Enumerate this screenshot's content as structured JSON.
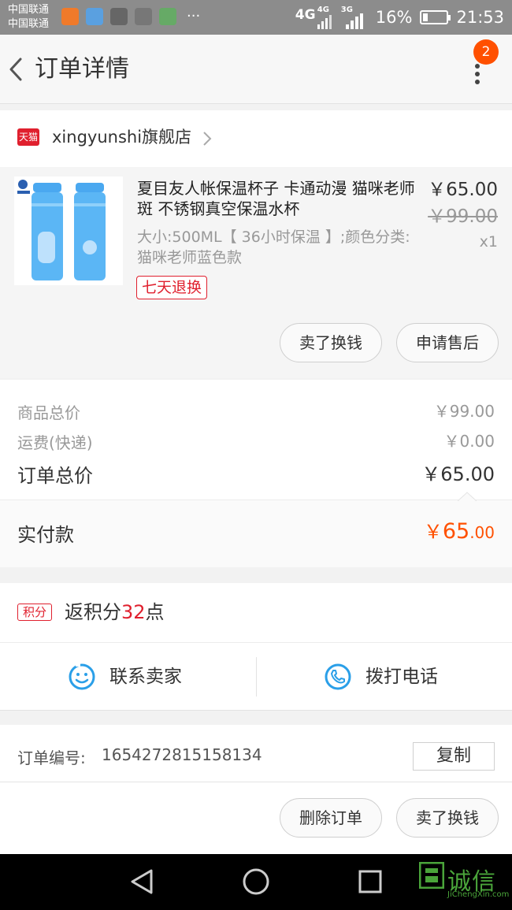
{
  "status_bar": {
    "carrier_1": "中国联通",
    "carrier_2": "中国联通",
    "more": "···",
    "net_1": "4G",
    "net_2": "4G",
    "net_3": "3G",
    "battery": "16%",
    "time": "21:53"
  },
  "header": {
    "title": "订单详情",
    "badge_count": "2"
  },
  "store": {
    "logo_text": "天猫",
    "name": "xingyunshi旗舰店"
  },
  "product": {
    "title": "夏目友人帐保温杯子 卡通动漫 猫咪老师斑 不锈钢真空保温水杯",
    "spec": "大小:500ML【 36小时保温 】;颜色分类:猫咪老师蓝色款",
    "tag": "七天退换",
    "price": "￥65.00",
    "original_price": "￥99.00",
    "quantity": "x1",
    "btn_sell": "卖了换钱",
    "btn_aftersale": "申请售后"
  },
  "summary": {
    "goods_label": "商品总价",
    "goods_value": "￥99.00",
    "shipping_label": "运费(快递)",
    "shipping_value": "￥0.00",
    "total_label": "订单总价",
    "total_value": "￥65.00",
    "paid_label": "实付款",
    "paid_currency": "￥",
    "paid_int": "65",
    "paid_dec": ".00"
  },
  "points": {
    "tag": "积分",
    "prefix": "返积分",
    "amount": "32",
    "suffix": "点"
  },
  "contact": {
    "seller": "联系卖家",
    "call": "拨打电话"
  },
  "order": {
    "number_label": "订单编号:",
    "number_value": "1654272815158134",
    "copy": "复制"
  },
  "actions": {
    "delete": "删除订单",
    "sell": "卖了换钱"
  },
  "watermark": {
    "text": "诚信",
    "url": "JiChengXin.com"
  },
  "colors": {
    "accent": "#ff5000",
    "tmall_red": "#e0202e",
    "icon_blue": "#2a9fe8"
  }
}
